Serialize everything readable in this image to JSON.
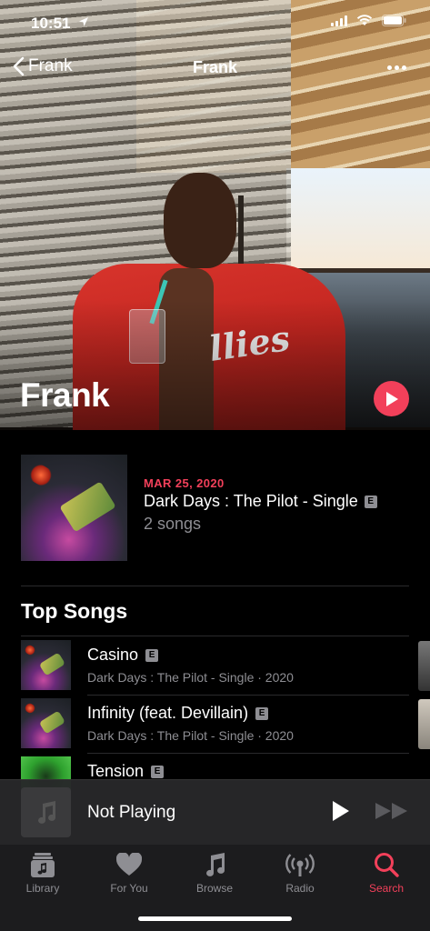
{
  "status_bar": {
    "time": "10:51"
  },
  "nav": {
    "back_label": "Frank",
    "title": "Frank"
  },
  "hero": {
    "artist_name": "Frank",
    "shirt_text": "llies"
  },
  "latest_release": {
    "date": "MAR 25, 2020",
    "title": "Dark Days : The Pilot - Single",
    "explicit": "E",
    "song_count": "2 songs"
  },
  "top_songs": {
    "heading": "Top Songs",
    "items": [
      {
        "title": "Casino",
        "explicit": "E",
        "subtitle": "Dark Days : The Pilot - Single · 2020"
      },
      {
        "title": "Infinity (feat. Devillain)",
        "explicit": "E",
        "subtitle": "Dark Days : The Pilot - Single · 2020"
      },
      {
        "title": "Tension",
        "explicit": "E",
        "subtitle": ""
      }
    ]
  },
  "mini_player": {
    "label": "Not Playing"
  },
  "tabs": [
    {
      "label": "Library",
      "icon": "library-icon"
    },
    {
      "label": "For You",
      "icon": "heart-icon"
    },
    {
      "label": "Browse",
      "icon": "music-note-icon"
    },
    {
      "label": "Radio",
      "icon": "radio-icon"
    },
    {
      "label": "Search",
      "icon": "search-icon",
      "active": true
    }
  ],
  "colors": {
    "accent": "#f2405a",
    "background": "#000000",
    "secondary_text": "#8e8e93"
  }
}
